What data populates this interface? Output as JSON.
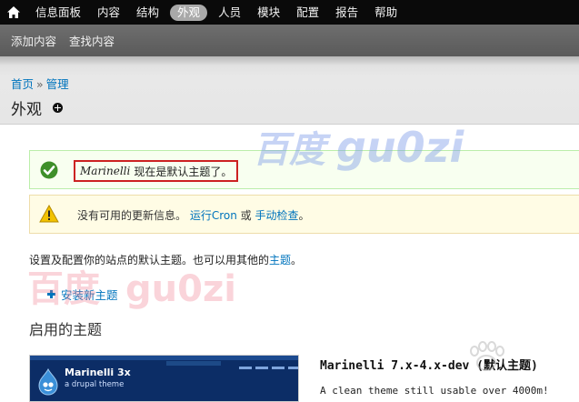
{
  "toolbar": {
    "items": [
      {
        "label": "信息面板"
      },
      {
        "label": "内容"
      },
      {
        "label": "结构"
      },
      {
        "label": "外观",
        "active": true
      },
      {
        "label": "人员"
      },
      {
        "label": "模块"
      },
      {
        "label": "配置"
      },
      {
        "label": "报告"
      },
      {
        "label": "帮助"
      }
    ],
    "home_icon": "home-icon"
  },
  "shortcuts": {
    "items": [
      {
        "label": "添加内容"
      },
      {
        "label": "查找内容"
      }
    ]
  },
  "header": {
    "breadcrumb": {
      "home": "首页",
      "separator": "»",
      "admin": "管理"
    },
    "title": "外观",
    "add_icon": "plus-circle-icon"
  },
  "messages": {
    "status": {
      "theme": "Marinelli",
      "text": "现在是默认主题了。",
      "icon": "check-circle-icon"
    },
    "warning": {
      "text1": "没有可用的更新信息。",
      "link1": "运行Cron",
      "text2": "或",
      "link2": "手动检查",
      "text3": "。",
      "icon": "warning-triangle-icon"
    }
  },
  "description": {
    "text": "设置及配置你的站点的默认主题。也可以用其他的",
    "link": "主题",
    "end": "。"
  },
  "install_link": "安装新主题",
  "section_title": "启用的主题",
  "theme": {
    "screenshot_title": "Marinelli 3x",
    "screenshot_subtitle": "a drupal theme",
    "name": "Marinelli 7.x-4.x-dev (默认主题)",
    "description": "A clean theme still usable over 4000m!"
  },
  "watermarks": {
    "top_cjk": "百度",
    "top_latin": "gu0zi",
    "mid_cjk": "百度",
    "mid_latin": "gu0zi"
  },
  "colors": {
    "link": "#0074bd",
    "toolbar_bg": "#0a0a0a",
    "highlight_border": "#cc2222",
    "status_bg": "#f8fff0",
    "warning_bg": "#fffce5"
  }
}
